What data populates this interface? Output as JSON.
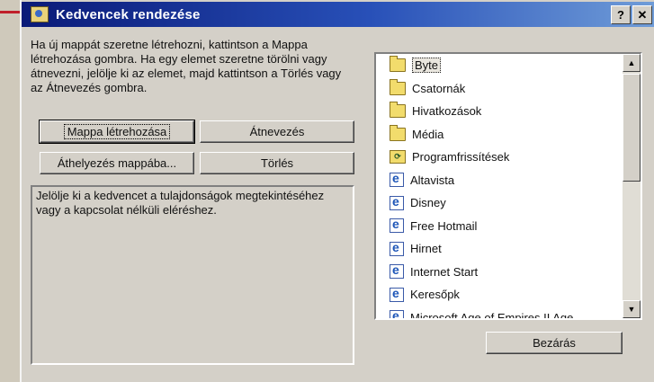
{
  "window": {
    "title": "Kedvencek rendezése",
    "help_label": "?",
    "close_label": "✕"
  },
  "description": "Ha új mappát szeretne létrehozni, kattintson a Mappa létrehozása gombra. Ha egy elemet szeretne törölni vagy átnevezni, jelölje ki az elemet, majd kattintson a Törlés vagy az Átnevezés gombra.",
  "buttons": {
    "create_folder": "Mappa létrehozása",
    "rename": "Átnevezés",
    "move_to_folder": "Áthelyezés mappába...",
    "delete": "Törlés",
    "close": "Bezárás"
  },
  "info_text": "Jelölje ki a kedvencet a tulajdonságok megtekintéséhez vagy a kapcsolat nélküli eléréshez.",
  "favorites": [
    {
      "label": "Byte",
      "icon": "folder-icon"
    },
    {
      "label": "Csatornák",
      "icon": "folder-icon"
    },
    {
      "label": "Hivatkozások",
      "icon": "folder-icon"
    },
    {
      "label": "Média",
      "icon": "folder-icon"
    },
    {
      "label": "Programfrissítések",
      "icon": "sync-folder-icon"
    },
    {
      "label": "Altavista",
      "icon": "ie-link-icon"
    },
    {
      "label": "Disney",
      "icon": "ie-link-icon"
    },
    {
      "label": "Free Hotmail",
      "icon": "ie-link-icon"
    },
    {
      "label": "Hirnet",
      "icon": "ie-link-icon"
    },
    {
      "label": "Internet Start",
      "icon": "ie-link-icon"
    },
    {
      "label": "Keresőpk",
      "icon": "ie-link-icon"
    },
    {
      "label": "Microsoft Age of Empires II Age...",
      "icon": "ie-link-icon"
    }
  ],
  "selected_index": 0,
  "scroll_icons": {
    "up": "scroll-up-arrow-icon",
    "down": "scroll-down-arrow-icon"
  }
}
